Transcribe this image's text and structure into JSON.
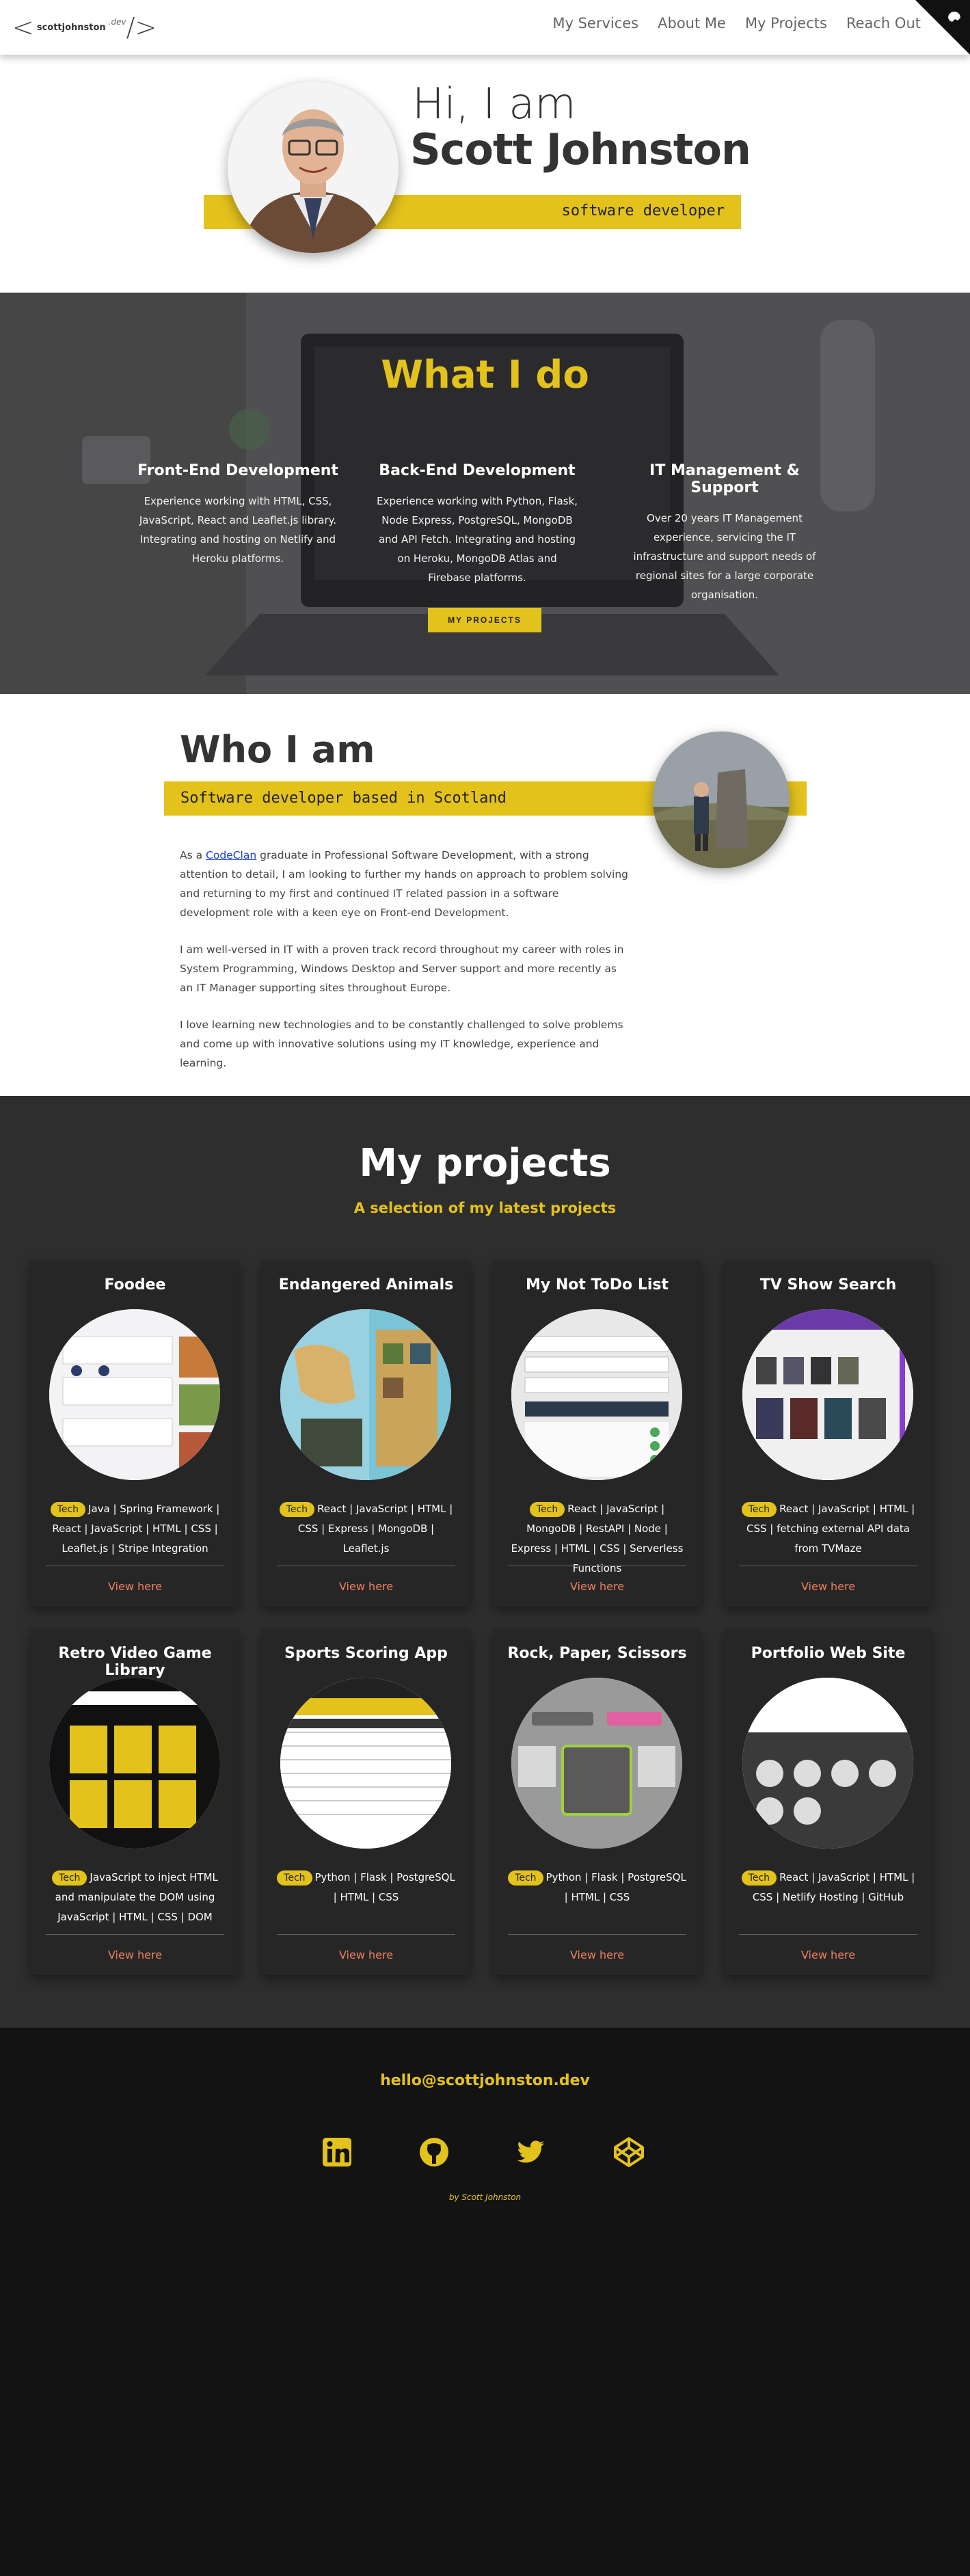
{
  "nav": {
    "logo_text": "scottjohnston",
    "logo_suffix": ".dev",
    "items": [
      "My Services",
      "About Me",
      "My Projects",
      "Reach Out"
    ]
  },
  "hero": {
    "greeting": "Hi, I am",
    "name": "Scott Johnston",
    "role": "software developer"
  },
  "what_i_do": {
    "title": "What I do",
    "columns": [
      {
        "title": "Front-End Development",
        "text": "Experience working with HTML, CSS, JavaScript, React and Leaflet.js library. Integrating and hosting on Netlify and Heroku platforms."
      },
      {
        "title": "Back-End Development",
        "text": "Experience working with Python, Flask, Node Express, PostgreSQL, MongoDB and API Fetch. Integrating and hosting on Heroku, MongoDB Atlas and Firebase platforms."
      },
      {
        "title": "IT Management & Support",
        "text": "Over 20 years IT Management experience, servicing the IT infrastructure and support needs of regional sites for a large corporate organisation."
      }
    ],
    "button": "MY PROJECTS"
  },
  "who_i_am": {
    "title": "Who I am",
    "tagline": "Software developer based in Scotland",
    "para1_prefix": "As a ",
    "para1_link": "CodeClan",
    "para1_rest": " graduate in Professional Software Development, with a strong attention to detail, I am looking to further my hands on approach to problem solving and returning to my first and continued IT related passion in a software development role with a keen eye on Front-end Development.",
    "para2": "I am well-versed in IT with a proven track record throughout my career with roles in System Programming, Windows Desktop and Server support and more recently as an IT Manager supporting sites throughout Europe.",
    "para3": "I love learning new technologies and to be constantly challenged to solve problems and come up with innovative solutions using my IT knowledge, experience and learning."
  },
  "projects": {
    "title": "My projects",
    "subtitle": "A selection of my latest projects",
    "tag": "Tech",
    "link_label": "View here",
    "cards": [
      {
        "title": "Foodee",
        "tech": "Java | Spring Framework | React | JavaScript | HTML | CSS | Leaflet.js | Stripe Integration"
      },
      {
        "title": "Endangered Animals",
        "tech": "React | JavaScript | HTML | CSS | Express | MongoDB | Leaflet.js"
      },
      {
        "title": "My Not ToDo List",
        "tech": "React | JavaScript | MongoDB | RestAPI | Node | Express | HTML | CSS | Serverless Functions"
      },
      {
        "title": "TV Show Search",
        "tech": "React | JavaScript | HTML | CSS | fetching external API data from TVMaze"
      },
      {
        "title": "Retro Video Game Library",
        "tech": "JavaScript to inject HTML and manipulate the DOM using JavaScript | HTML | CSS | DOM"
      },
      {
        "title": "Sports Scoring App",
        "tech": "Python | Flask | PostgreSQL | HTML | CSS"
      },
      {
        "title": "Rock, Paper, Scissors",
        "tech": "Python | Flask | PostgreSQL | HTML | CSS"
      },
      {
        "title": "Portfolio Web Site",
        "tech": "React | JavaScript | HTML | CSS | Netlify Hosting | GitHub"
      }
    ]
  },
  "footer": {
    "email": "hello@scottjohnston.dev",
    "social_icons": [
      "linkedin-icon",
      "github-icon",
      "twitter-icon",
      "codepen-icon"
    ],
    "byline": "by Scott Johnston"
  },
  "colors": {
    "accent": "#e3c21c",
    "dark": "#2e2e2e",
    "footer": "#131313",
    "link": "#f08060"
  }
}
